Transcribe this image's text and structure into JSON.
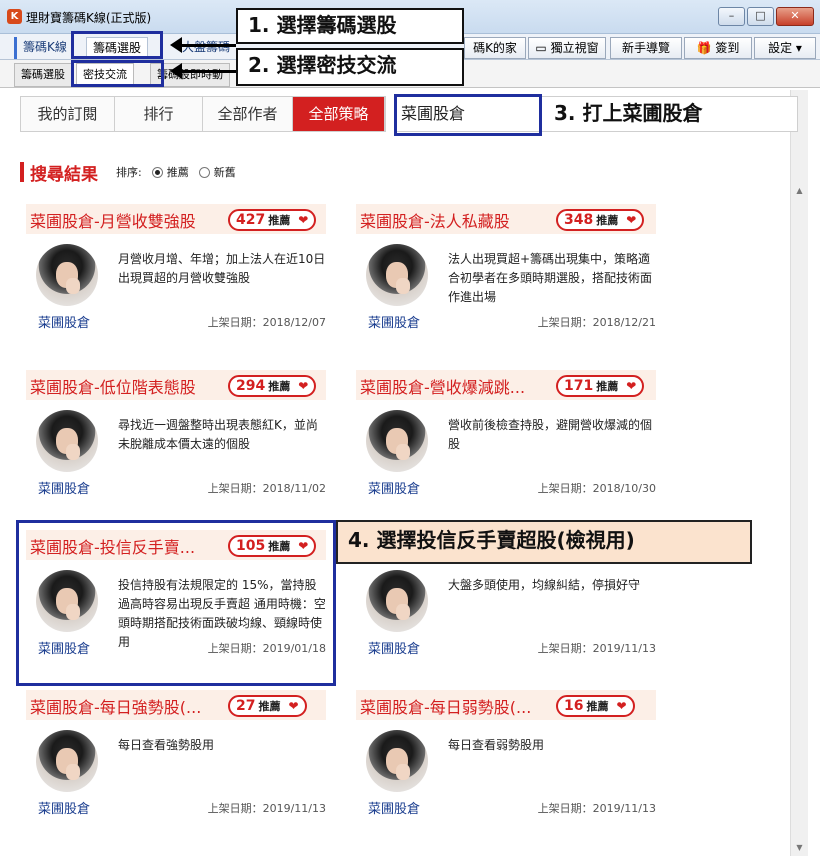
{
  "window": {
    "title": "理財寶籌碼K線(正式版)"
  },
  "tabs_main": [
    {
      "label": "籌碼K線"
    },
    {
      "label": "籌碼選股"
    },
    {
      "label": "大盤籌碼"
    }
  ],
  "toolbar": {
    "home_partial": "碼K的家",
    "standalone_window": "獨立視窗",
    "new_user_guide": "新手導覽",
    "checkin": "簽到",
    "settings": "設定"
  },
  "tabs_sub": [
    {
      "label": "籌碼選股"
    },
    {
      "label": "密技交流"
    },
    {
      "label": "籌碼股即時動"
    }
  ],
  "subnav": [
    {
      "label": "我的訂閱"
    },
    {
      "label": "排行"
    },
    {
      "label": "全部作者"
    },
    {
      "label": "全部策略"
    }
  ],
  "search": {
    "value": "菜圃股倉"
  },
  "results": {
    "title": "搜尋結果",
    "sort_label": "排序:",
    "sort_options": [
      {
        "label": "推薦",
        "selected": true
      },
      {
        "label": "新舊",
        "selected": false
      }
    ]
  },
  "cards": [
    {
      "title": "菜圃股倉-月營收雙強股",
      "count": "427",
      "rec": "推薦",
      "desc": "月營收月增、年增；加上法人在近10日出現買超的月營收雙強股",
      "author": "菜圃股倉",
      "date": "上架日期：2018/12/07"
    },
    {
      "title": "菜圃股倉-法人私藏股",
      "count": "348",
      "rec": "推薦",
      "desc": "法人出現買超+籌碼出現集中，策略適合初學者在多頭時期選股，搭配技術面作進出場",
      "author": "菜圃股倉",
      "date": "上架日期：2018/12/21"
    },
    {
      "title": "菜圃股倉-低位階表態股",
      "count": "294",
      "rec": "推薦",
      "desc": "尋找近一週盤整時出現表態紅K，並尚未脫離成本價太遠的個股",
      "author": "菜圃股倉",
      "date": "上架日期：2018/11/02"
    },
    {
      "title": "菜圃股倉-營收爆減跳...",
      "count": "171",
      "rec": "推薦",
      "desc": "營收前後檢查持股，避開營收爆減的個股",
      "author": "菜圃股倉",
      "date": "上架日期：2018/10/30"
    },
    {
      "title": "菜圃股倉-投信反手賣...",
      "count": "105",
      "rec": "推薦",
      "desc": "投信持股有法規限定的 15%，當持股過高時容易出現反手賣超 通用時機：空頭時期搭配技術面跌破均線、頸線時使用",
      "author": "菜圃股倉",
      "date": "上架日期：2019/01/18"
    },
    {
      "title": "",
      "count": "",
      "rec": "",
      "desc": "大盤多頭使用，均線糾結，停損好守",
      "author": "菜圃股倉",
      "date": "上架日期：2019/11/13"
    },
    {
      "title": "菜圃股倉-每日強勢股(...",
      "count": "27",
      "rec": "推薦",
      "desc": "每日查看強勢股用",
      "author": "菜圃股倉",
      "date": "上架日期：2019/11/13"
    },
    {
      "title": "菜圃股倉-每日弱勢股(...",
      "count": "16",
      "rec": "推薦",
      "desc": "每日查看弱勢股用",
      "author": "菜圃股倉",
      "date": "上架日期：2019/11/13"
    }
  ],
  "annotations": {
    "step1": "1. 選擇籌碼選股",
    "step2": "2. 選擇密技交流",
    "step3": "3. 打上菜圃股倉",
    "step4": "4. 選擇投信反手賣超股(檢視用)"
  }
}
